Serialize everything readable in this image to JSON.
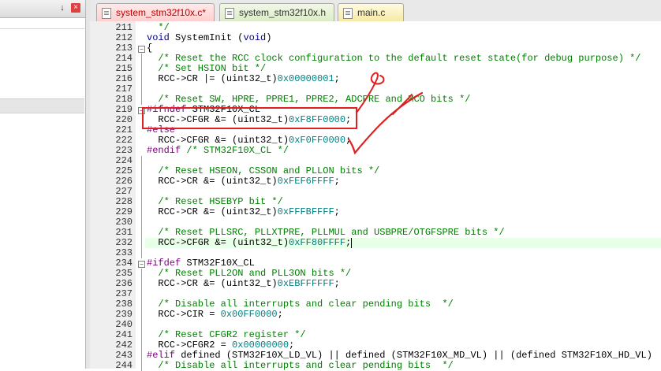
{
  "left_panel": {
    "pin_glyph": "↓",
    "close_glyph": "×"
  },
  "tabs": [
    {
      "label": "system_stm32f10x.c*",
      "active": true
    },
    {
      "label": "system_stm32f10x.h",
      "active": false
    },
    {
      "label": "main.c",
      "active": false
    }
  ],
  "editor": {
    "lines": [
      {
        "num": "211",
        "segs": [
          {
            "t": "  */",
            "c": "cm"
          }
        ]
      },
      {
        "num": "212",
        "segs": [
          {
            "t": "void",
            "c": "kw"
          },
          {
            "t": " SystemInit (",
            "c": "norm"
          },
          {
            "t": "void",
            "c": "kw"
          },
          {
            "t": ")",
            "c": "norm"
          }
        ]
      },
      {
        "num": "213",
        "segs": [
          {
            "t": "{",
            "c": "norm"
          }
        ]
      },
      {
        "num": "214",
        "segs": [
          {
            "t": "  /* Reset the RCC clock configuration to the default reset state(for debug purpose) */",
            "c": "cm"
          }
        ]
      },
      {
        "num": "215",
        "segs": [
          {
            "t": "  /* Set HSION bit */",
            "c": "cm"
          }
        ]
      },
      {
        "num": "216",
        "segs": [
          {
            "t": "  RCC->CR |= (uint32_t)",
            "c": "norm"
          },
          {
            "t": "0x00000001",
            "c": "num"
          },
          {
            "t": ";",
            "c": "norm"
          }
        ]
      },
      {
        "num": "217",
        "segs": []
      },
      {
        "num": "218",
        "segs": [
          {
            "t": "  /* Reset SW, HPRE, PPRE1, PPRE2, ADCPRE and MCO bits */",
            "c": "cm"
          }
        ]
      },
      {
        "num": "219",
        "segs": [
          {
            "t": "#ifndef",
            "c": "pp"
          },
          {
            "t": " STM32F10X_CL",
            "c": "norm"
          }
        ]
      },
      {
        "num": "220",
        "segs": [
          {
            "t": "  RCC->CFGR &= (uint32_t)",
            "c": "norm"
          },
          {
            "t": "0xF8FF0000",
            "c": "num"
          },
          {
            "t": ";",
            "c": "norm"
          }
        ]
      },
      {
        "num": "221",
        "segs": [
          {
            "t": "#else",
            "c": "pp"
          }
        ]
      },
      {
        "num": "222",
        "segs": [
          {
            "t": "  RCC->CFGR &= (uint32_t)",
            "c": "norm"
          },
          {
            "t": "0xF0FF0000",
            "c": "num"
          },
          {
            "t": ";",
            "c": "norm"
          }
        ]
      },
      {
        "num": "223",
        "segs": [
          {
            "t": "#endif",
            "c": "pp"
          },
          {
            "t": " /* STM32F10X_CL */",
            "c": "cm"
          }
        ]
      },
      {
        "num": "224",
        "segs": []
      },
      {
        "num": "225",
        "segs": [
          {
            "t": "  /* Reset HSEON, CSSON and PLLON bits */",
            "c": "cm"
          }
        ]
      },
      {
        "num": "226",
        "segs": [
          {
            "t": "  RCC->CR &= (uint32_t)",
            "c": "norm"
          },
          {
            "t": "0xFEF6FFFF",
            "c": "num"
          },
          {
            "t": ";",
            "c": "norm"
          }
        ]
      },
      {
        "num": "227",
        "segs": []
      },
      {
        "num": "228",
        "segs": [
          {
            "t": "  /* Reset HSEBYP bit */",
            "c": "cm"
          }
        ]
      },
      {
        "num": "229",
        "segs": [
          {
            "t": "  RCC->CR &= (uint32_t)",
            "c": "norm"
          },
          {
            "t": "0xFFFBFFFF",
            "c": "num"
          },
          {
            "t": ";",
            "c": "norm"
          }
        ]
      },
      {
        "num": "230",
        "segs": []
      },
      {
        "num": "231",
        "segs": [
          {
            "t": "  /* Reset PLLSRC, PLLXTPRE, PLLMUL and USBPRE/OTGFSPRE bits */",
            "c": "cm"
          }
        ]
      },
      {
        "num": "232",
        "segs": [
          {
            "t": "  RCC->CFGR &= (uint32_t)",
            "c": "norm"
          },
          {
            "t": "0xFF80FFFF",
            "c": "num"
          },
          {
            "t": ";",
            "c": "norm"
          }
        ]
      },
      {
        "num": "233",
        "segs": []
      },
      {
        "num": "234",
        "segs": [
          {
            "t": "#ifdef",
            "c": "pp"
          },
          {
            "t": " STM32F10X_CL",
            "c": "norm"
          }
        ]
      },
      {
        "num": "235",
        "segs": [
          {
            "t": "  /* Reset PLL2ON and PLL3ON bits */",
            "c": "cm"
          }
        ]
      },
      {
        "num": "236",
        "segs": [
          {
            "t": "  RCC->CR &= (uint32_t)",
            "c": "norm"
          },
          {
            "t": "0xEBFFFFFF",
            "c": "num"
          },
          {
            "t": ";",
            "c": "norm"
          }
        ]
      },
      {
        "num": "237",
        "segs": []
      },
      {
        "num": "238",
        "segs": [
          {
            "t": "  /* Disable all interrupts and clear pending bits  */",
            "c": "cm"
          }
        ]
      },
      {
        "num": "239",
        "segs": [
          {
            "t": "  RCC->CIR = ",
            "c": "norm"
          },
          {
            "t": "0x00FF0000",
            "c": "num"
          },
          {
            "t": ";",
            "c": "norm"
          }
        ]
      },
      {
        "num": "240",
        "segs": []
      },
      {
        "num": "241",
        "segs": [
          {
            "t": "  /* Reset CFGR2 register */",
            "c": "cm"
          }
        ]
      },
      {
        "num": "242",
        "segs": [
          {
            "t": "  RCC->CFGR2 = ",
            "c": "norm"
          },
          {
            "t": "0x00000000",
            "c": "num"
          },
          {
            "t": ";",
            "c": "norm"
          }
        ]
      },
      {
        "num": "243",
        "segs": [
          {
            "t": "#elif",
            "c": "pp"
          },
          {
            "t": " defined (STM32F10X_LD_VL) || defined (STM32F10X_MD_VL) || (defined STM32F10X_HD_VL)",
            "c": "norm"
          }
        ]
      },
      {
        "num": "244",
        "segs": [
          {
            "t": "  /* Disable all interrupts and clear pending bits  */",
            "c": "cm"
          }
        ]
      }
    ]
  },
  "colors": {
    "annotation_red": "#e02020",
    "comment": "#008000",
    "keyword": "#00008b",
    "preprocessor": "#800080",
    "number": "#008080"
  }
}
